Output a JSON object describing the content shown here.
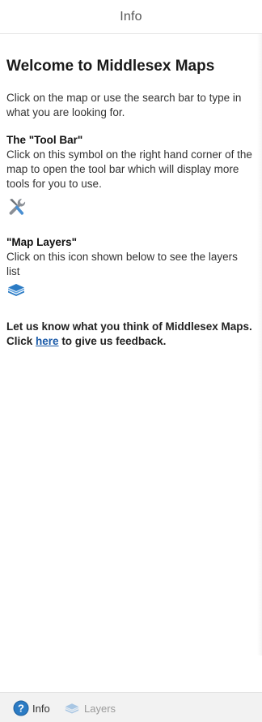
{
  "header": {
    "title": "Info"
  },
  "info": {
    "welcome_title": "Welcome to Middlesex Maps",
    "intro": "Click on the map or use the search bar to type in what you are looking for.",
    "toolbar_heading": "The \"Tool Bar\"",
    "toolbar_text": "Click on this symbol on the right hand corner of the map to open the tool bar which will display more tools for you to use.",
    "toolbar_icon": "tools-icon",
    "layers_heading": "\"Map Layers\"",
    "layers_text": "Click on this icon shown below to see the layers list",
    "layers_icon": "layers-icon",
    "feedback_before": "Let us know what you think of Middlesex Maps. Click ",
    "feedback_link": "here",
    "feedback_after": " to give us feedback."
  },
  "tabs": [
    {
      "label": "Info",
      "icon": "help-circle-icon",
      "active": true
    },
    {
      "label": "Layers",
      "icon": "layers-icon",
      "active": false
    }
  ],
  "colors": {
    "link": "#1a5aa8",
    "accent_blue": "#2b7bc4",
    "tab_bar": "#f2f2f2"
  }
}
